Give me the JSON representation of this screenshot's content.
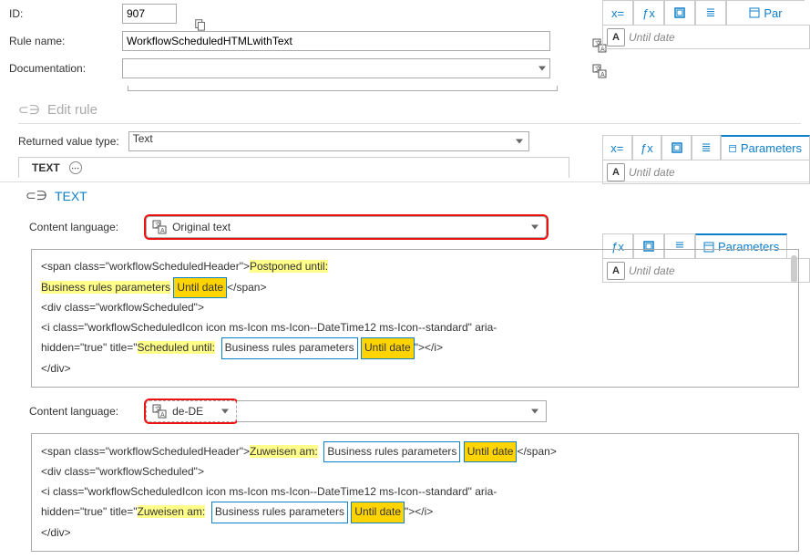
{
  "general": {
    "id_label": "ID:",
    "id_value": "907",
    "rule_name_label": "Rule name:",
    "rule_name_value": "WorkflowScheduledHTMLwithText",
    "documentation_label": "Documentation:",
    "documentation_value": ""
  },
  "edit_rule": {
    "header": "Edit rule",
    "returned_label": "Returned value type:",
    "returned_value": "Text",
    "text_tag": "TEXT"
  },
  "text_section": {
    "header": "TEXT",
    "content_language_label": "Content language:",
    "original_text": "Original text",
    "de_de": "de-DE",
    "code_original": {
      "line1a": "<span class=\"workflowScheduledHeader\">",
      "hl1": "Postponed until:",
      "line2a": "Business rules parameters",
      "until_date": "Until date",
      "span_close": "</span>",
      "line3": "<div class=\"workflowScheduled\">",
      "line4a": "    <i class=\"workflowScheduledIcon icon ms-Icon ms-Icon--DateTime12 ms-Icon--standard\" aria-",
      "line5a": "hidden=\"true\" title=\"",
      "hl2": "Scheduled until:",
      "line5b": "\"></i>",
      "line6": "</div>"
    },
    "code_de": {
      "line1a": "<span class=\"workflowScheduledHeader\">",
      "hl1": "Zuweisen am:",
      "span_close": "</span>",
      "line2": "<div class=\"workflowScheduled\">",
      "line3a": "    <i class=\"workflowScheduledIcon icon ms-Icon ms-Icon--DateTime12 ms-Icon--standard\" aria-",
      "line4a": "hidden=\"true\" title=\"",
      "hl2": "Zuweisen am:",
      "line4b": "\"></i>",
      "line5": "</div>"
    }
  },
  "right_panel": {
    "parameters_label": "Parameters",
    "par_cut": "Par",
    "field_text": "Until date",
    "badge": "A"
  },
  "icons": {
    "xeq": "x=",
    "fx": "ƒx",
    "list": "≣",
    "grid": "▦"
  }
}
